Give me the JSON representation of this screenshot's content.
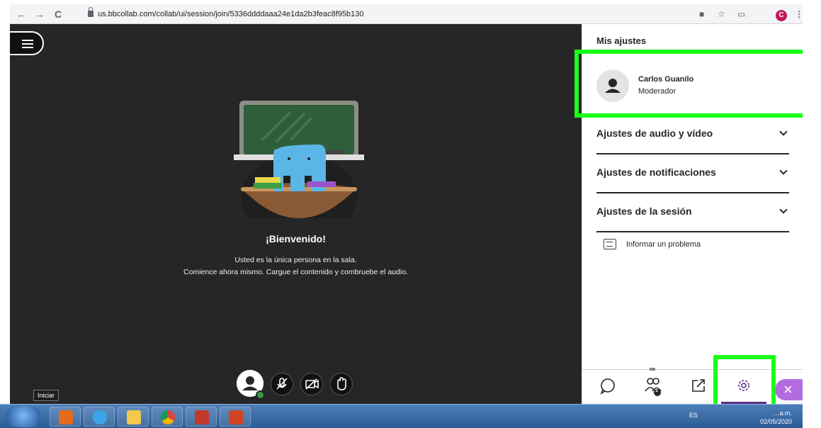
{
  "browser": {
    "back_icon": "←",
    "forward_icon": "→",
    "reload_icon": "C",
    "url": "us.bbcollab.com/collab/ui/session/join/5336ddddaaa24e1da2b3feac8f95b130",
    "profile_initial": "C"
  },
  "session": {
    "welcome_title": "¡Bienvenido!",
    "welcome_line1": "Usted es la única persona en la sala.",
    "welcome_line2": "Comience ahora mismo. Cargue el contenido y combruebe el audio.",
    "tooltip": "Iniciar"
  },
  "panel": {
    "title": "Mis ajustes",
    "user_name": "Carlos Guanilo",
    "user_role": "Moderador",
    "settings": [
      {
        "label": "Ajustes de audio y vídeo"
      },
      {
        "label": "Ajustes de notificaciones"
      },
      {
        "label": "Ajustes de la sesión"
      }
    ],
    "report_problem": "Informar un problema",
    "participant_badge": "1",
    "close_icon": "×"
  },
  "taskbar": {
    "language": "ES",
    "time": "…a.m.",
    "date": "02/05/2020"
  },
  "colors": {
    "stage_bg": "#262626",
    "highlight": "#1bff1b",
    "accent_purple": "#5a2d82",
    "close_pill": "#b46be0"
  }
}
